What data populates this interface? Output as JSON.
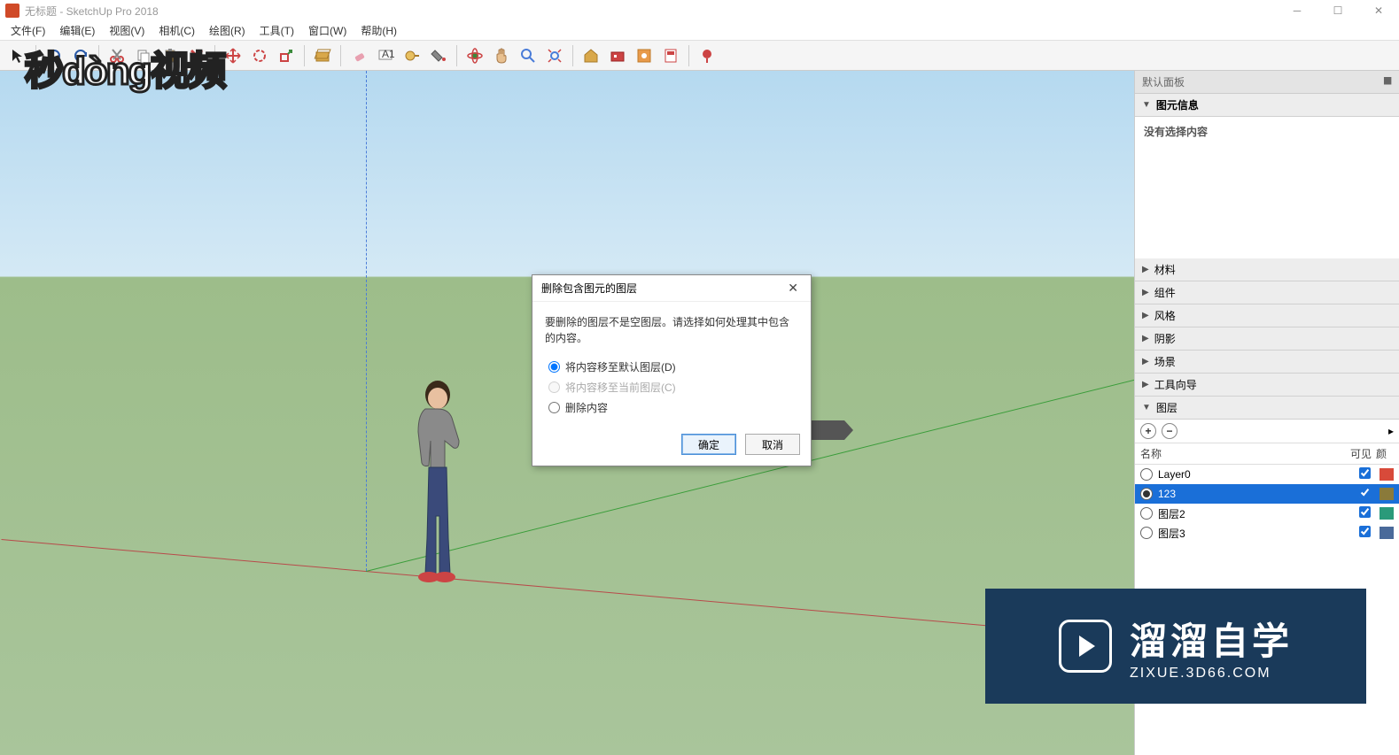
{
  "title_bar": {
    "title": "无标题 - SketchUp Pro 2018"
  },
  "menu": {
    "items": [
      "文件(F)",
      "编辑(E)",
      "视图(V)",
      "相机(C)",
      "绘图(R)",
      "工具(T)",
      "窗口(W)",
      "帮助(H)"
    ]
  },
  "right_panel": {
    "tray_title": "默认面板",
    "entity_info": {
      "title": "图元信息",
      "body": "没有选择内容"
    },
    "sections": [
      "材料",
      "组件",
      "风格",
      "阴影",
      "场景",
      "工具向导"
    ],
    "layers_title": "图层",
    "layers_toolbar": {
      "add": "+",
      "remove": "−",
      "menu": "▸"
    },
    "layers_headers": {
      "name": "名称",
      "visible": "可见",
      "color": "颜"
    },
    "layers": [
      {
        "name": "Layer0",
        "visible": true,
        "color": "#d84a3a",
        "active": false,
        "selected": false
      },
      {
        "name": "123",
        "visible": true,
        "color": "#8a7a3a",
        "active": true,
        "selected": true
      },
      {
        "name": "图层2",
        "visible": true,
        "color": "#2a9a7a",
        "active": false,
        "selected": false
      },
      {
        "name": "图层3",
        "visible": true,
        "color": "#4a6a9a",
        "active": false,
        "selected": false
      }
    ]
  },
  "dialog": {
    "title": "删除包含图元的图层",
    "message": "要删除的图层不是空图层。请选择如何处理其中包含的内容。",
    "options": [
      {
        "label": "将内容移至默认图层(D)",
        "checked": true,
        "disabled": false
      },
      {
        "label": "将内容移至当前图层(C)",
        "checked": false,
        "disabled": true
      },
      {
        "label": "删除内容",
        "checked": false,
        "disabled": false
      }
    ],
    "ok": "确定",
    "cancel": "取消"
  },
  "watermarks": {
    "top_left": "秒dòng视频",
    "bottom_right_main": "溜溜自学",
    "bottom_right_sub": "ZIXUE.3D66.COM"
  }
}
